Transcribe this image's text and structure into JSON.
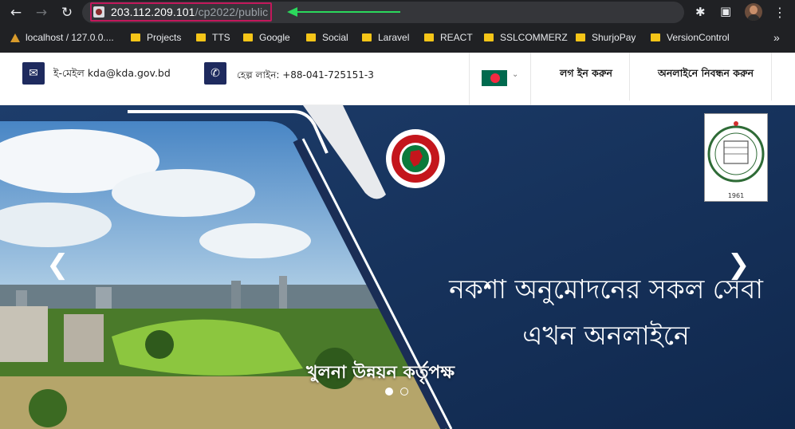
{
  "browser": {
    "url_host": "203.112.209.101",
    "url_path": "/cp2022/public",
    "bookmarks": [
      {
        "label": "localhost / 127.0.0....",
        "type": "site"
      },
      {
        "label": "Projects",
        "type": "folder"
      },
      {
        "label": "TTS",
        "type": "folder"
      },
      {
        "label": "Google",
        "type": "folder"
      },
      {
        "label": "Social",
        "type": "folder"
      },
      {
        "label": "Laravel",
        "type": "folder"
      },
      {
        "label": "REACT",
        "type": "folder"
      },
      {
        "label": "SSLCOMMERZ",
        "type": "folder"
      },
      {
        "label": "ShurjoPay",
        "type": "folder"
      },
      {
        "label": "VersionControl",
        "type": "folder"
      }
    ],
    "more_bookmarks": "»",
    "annotation_color": "#2bd85c",
    "highlight_color": "#c2185b"
  },
  "header": {
    "email_label": "ই-মেইল kda@kda.gov.bd",
    "helpline_label": "হেল্প লাইন: +88-041-725151-3",
    "login_label": "লগ ইন করুন",
    "register_label": "অনলাইনে নিবন্ধন করুন",
    "icons": {
      "email": "envelope-icon",
      "phone": "phone-icon",
      "language": "bangladesh-flag-icon"
    }
  },
  "hero": {
    "title_line1": "নকশা অনুমোদনের সকল সেবা",
    "title_line2": "এখন অনলাইনে",
    "caption": "খুলনা উন্নয়ন কর্তৃপক্ষ",
    "prev": "❮",
    "next": "❯",
    "slides": 2,
    "active_slide": 1,
    "kda_logo_year": "1961",
    "colors": {
      "panel": "#17345e",
      "accent": "#1e2a5e"
    }
  }
}
